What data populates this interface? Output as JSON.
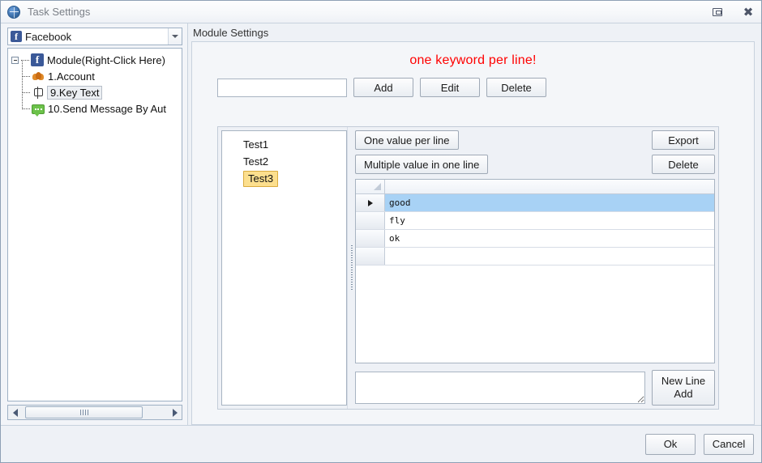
{
  "window": {
    "title": "Task Settings",
    "app_icon": "globe-icon",
    "restore_button": "restore-icon",
    "close_button": "close-icon"
  },
  "sidebar": {
    "combo": {
      "icon": "facebook-icon",
      "value": "Facebook",
      "arrow": "chevron-down-icon"
    },
    "tree": [
      {
        "label": "Module(Right-Click Here)",
        "icon": "facebook-icon",
        "level": 0,
        "expanded": true,
        "selected": false
      },
      {
        "label": "1.Account",
        "icon": "people-icon",
        "level": 1,
        "selected": false
      },
      {
        "label": "9.Key Text",
        "icon": "key-text-icon",
        "level": 1,
        "selected": true
      },
      {
        "label": "10.Send Message By Aut",
        "icon": "message-icon",
        "level": 1,
        "selected": false
      }
    ],
    "scrollbar": {
      "left_arrow": "scroll-left-icon",
      "right_arrow": "scroll-right-icon"
    }
  },
  "main": {
    "header": "Module Settings",
    "banner": "one keyword per line!",
    "banner_color": "#ff0000",
    "keyword_input": {
      "value": "",
      "placeholder": ""
    },
    "buttons": {
      "add": "Add",
      "edit": "Edit",
      "delete": "Delete"
    },
    "keyword_list": [
      {
        "label": "Test1",
        "selected": false
      },
      {
        "label": "Test2",
        "selected": false
      },
      {
        "label": "Test3",
        "selected": true
      }
    ],
    "selection_color": "#fcdf8e",
    "grid_tools": {
      "one_value_per_line": "One value per line",
      "multiple_value_in_one_line": "Multiple value in one line",
      "export": "Export",
      "delete": "Delete"
    },
    "grid": {
      "columns": [
        ""
      ],
      "rows": [
        {
          "value": "good",
          "selected": true
        },
        {
          "value": "fly",
          "selected": false
        },
        {
          "value": "ok",
          "selected": false
        },
        {
          "value": "",
          "selected": false
        }
      ],
      "selected_row_color": "#a8d2f5"
    },
    "memo": {
      "value": "",
      "placeholder": ""
    },
    "new_line_add": {
      "line1": "New Line",
      "line2": "Add"
    }
  },
  "footer": {
    "ok": "Ok",
    "cancel": "Cancel"
  }
}
